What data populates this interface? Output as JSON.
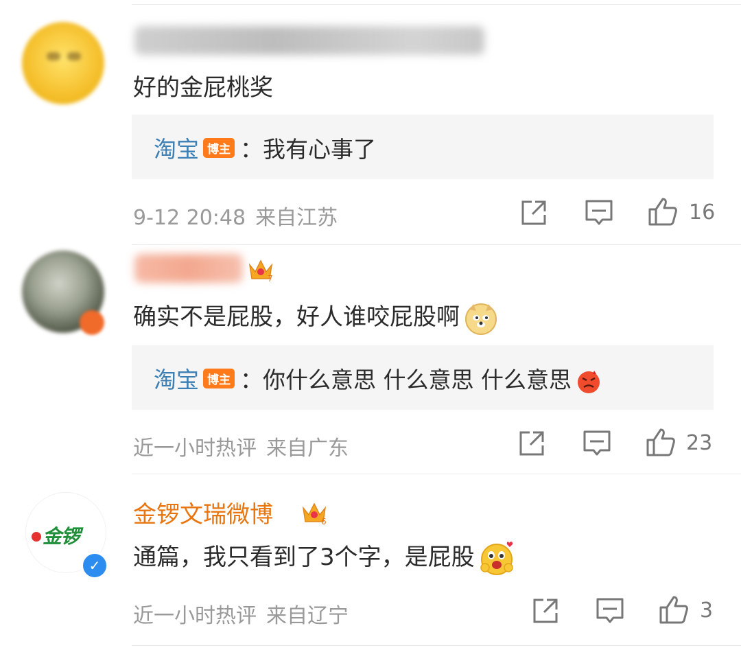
{
  "comments": [
    {
      "text": "好的金屁桃奖",
      "reply": {
        "user": "淘宝",
        "badge": "博主",
        "text": "：我有心事了"
      },
      "time": "9-12 20:48",
      "location": "来自江苏",
      "likes": "16"
    },
    {
      "text": "确实不是屁股，好人谁咬屁股啊",
      "reply": {
        "user": "淘宝",
        "badge": "博主",
        "text": "：你什么意思 什么意思 什么意思"
      },
      "time": "近一小时热评",
      "location": "来自广东",
      "likes": "23"
    },
    {
      "user": "金锣文瑞微博",
      "avatar_text": "金锣",
      "text": "通篇，我只看到了3个字，是屁股",
      "time": "近一小时热评",
      "location": "来自辽宁",
      "likes": "3"
    }
  ],
  "icons": [
    "share-icon",
    "comment-icon",
    "like-icon",
    "crown-icon",
    "doge-emoji",
    "angry-emoji",
    "shy-emoji",
    "verified-icon"
  ],
  "colors": {
    "reply_user": "#3b7fb5",
    "badge": "#ff7a1a",
    "username_vip": "#e8750f",
    "meta": "#999999"
  }
}
